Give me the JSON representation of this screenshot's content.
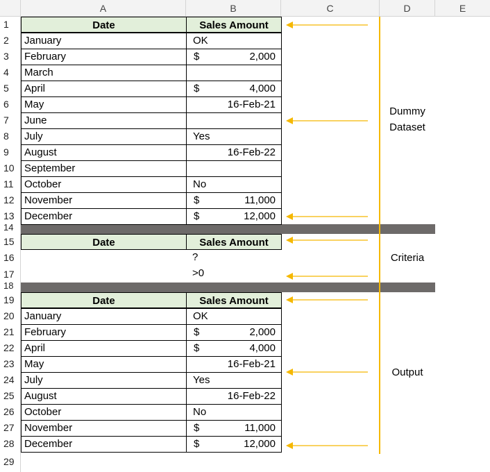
{
  "columns": [
    "A",
    "B",
    "C",
    "D",
    "E"
  ],
  "row_numbers": [
    "1",
    "2",
    "3",
    "4",
    "5",
    "6",
    "7",
    "8",
    "9",
    "10",
    "11",
    "12",
    "13",
    "14",
    "15",
    "16",
    "17",
    "18",
    "19",
    "20",
    "21",
    "22",
    "23",
    "24",
    "25",
    "26",
    "27",
    "28",
    "29"
  ],
  "headers": {
    "date": "Date",
    "sales": "Sales Amount"
  },
  "dataset": [
    {
      "date": "January",
      "cur": "",
      "value": "OK"
    },
    {
      "date": "February",
      "cur": "$",
      "value": "2,000"
    },
    {
      "date": "March",
      "cur": "",
      "value": ""
    },
    {
      "date": "April",
      "cur": "$",
      "value": "4,000"
    },
    {
      "date": "May",
      "cur": "",
      "value": "16-Feb-21"
    },
    {
      "date": "June",
      "cur": "",
      "value": ""
    },
    {
      "date": "July",
      "cur": "",
      "value": "Yes"
    },
    {
      "date": "August",
      "cur": "",
      "value": "16-Feb-22"
    },
    {
      "date": "September",
      "cur": "",
      "value": ""
    },
    {
      "date": "October",
      "cur": "",
      "value": "No"
    },
    {
      "date": "November",
      "cur": "$",
      "value": "11,000"
    },
    {
      "date": "December",
      "cur": "$",
      "value": "12,000"
    }
  ],
  "criteria": [
    {
      "date": "",
      "value": "?"
    },
    {
      "date": "",
      "value": ">0"
    }
  ],
  "output": [
    {
      "date": "January",
      "cur": "",
      "value": "OK"
    },
    {
      "date": "February",
      "cur": "$",
      "value": "2,000"
    },
    {
      "date": "April",
      "cur": "$",
      "value": "4,000"
    },
    {
      "date": "May",
      "cur": "",
      "value": "16-Feb-21"
    },
    {
      "date": "July",
      "cur": "",
      "value": "Yes"
    },
    {
      "date": "August",
      "cur": "",
      "value": "16-Feb-22"
    },
    {
      "date": "October",
      "cur": "",
      "value": "No"
    },
    {
      "date": "November",
      "cur": "$",
      "value": "11,000"
    },
    {
      "date": "December",
      "cur": "$",
      "value": "12,000"
    }
  ],
  "labels": {
    "dataset_line1": "Dummy",
    "dataset_line2": "Dataset",
    "criteria": "Criteria",
    "output": "Output"
  },
  "colors": {
    "header_fill": "#e2efda",
    "separator": "#6d6a69",
    "accent": "#f5b800"
  }
}
